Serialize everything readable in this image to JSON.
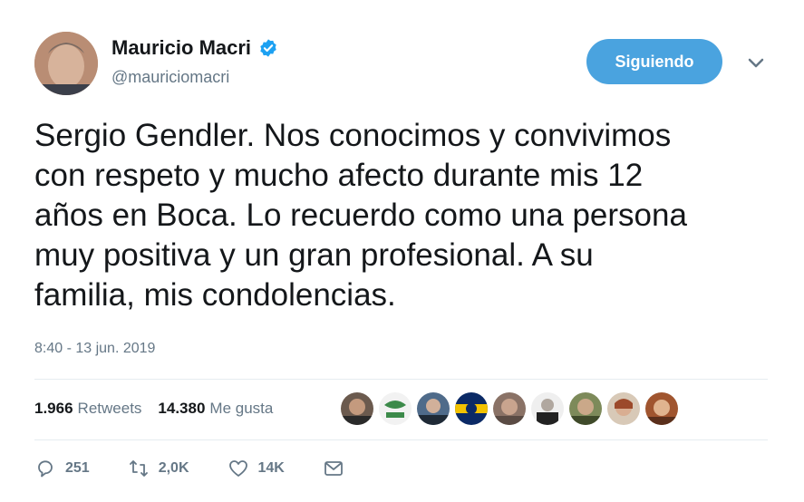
{
  "author": {
    "name": "Mauricio Macri",
    "handle": "@mauriciomacri"
  },
  "follow_button_label": "Siguiendo",
  "tweet": {
    "text": "Sergio Gendler. Nos conocimos y convivimos\ncon respeto y mucho afecto durante mis 12\naños en Boca. Lo recuerdo como una persona\nmuy positiva y un gran profesional. A su\nfamilia, mis condolencias.",
    "timestamp": "8:40 - 13 jun. 2019"
  },
  "stats": {
    "retweets_count": "1.966",
    "retweets_label": "Retweets",
    "likes_count": "14.380",
    "likes_label": "Me gusta"
  },
  "actions": {
    "reply_count": "251",
    "retweet_count": "2,0K",
    "like_count": "14K"
  },
  "colors": {
    "accent": "#4aa3df",
    "muted": "#657786",
    "verified": "#1da1f2"
  }
}
